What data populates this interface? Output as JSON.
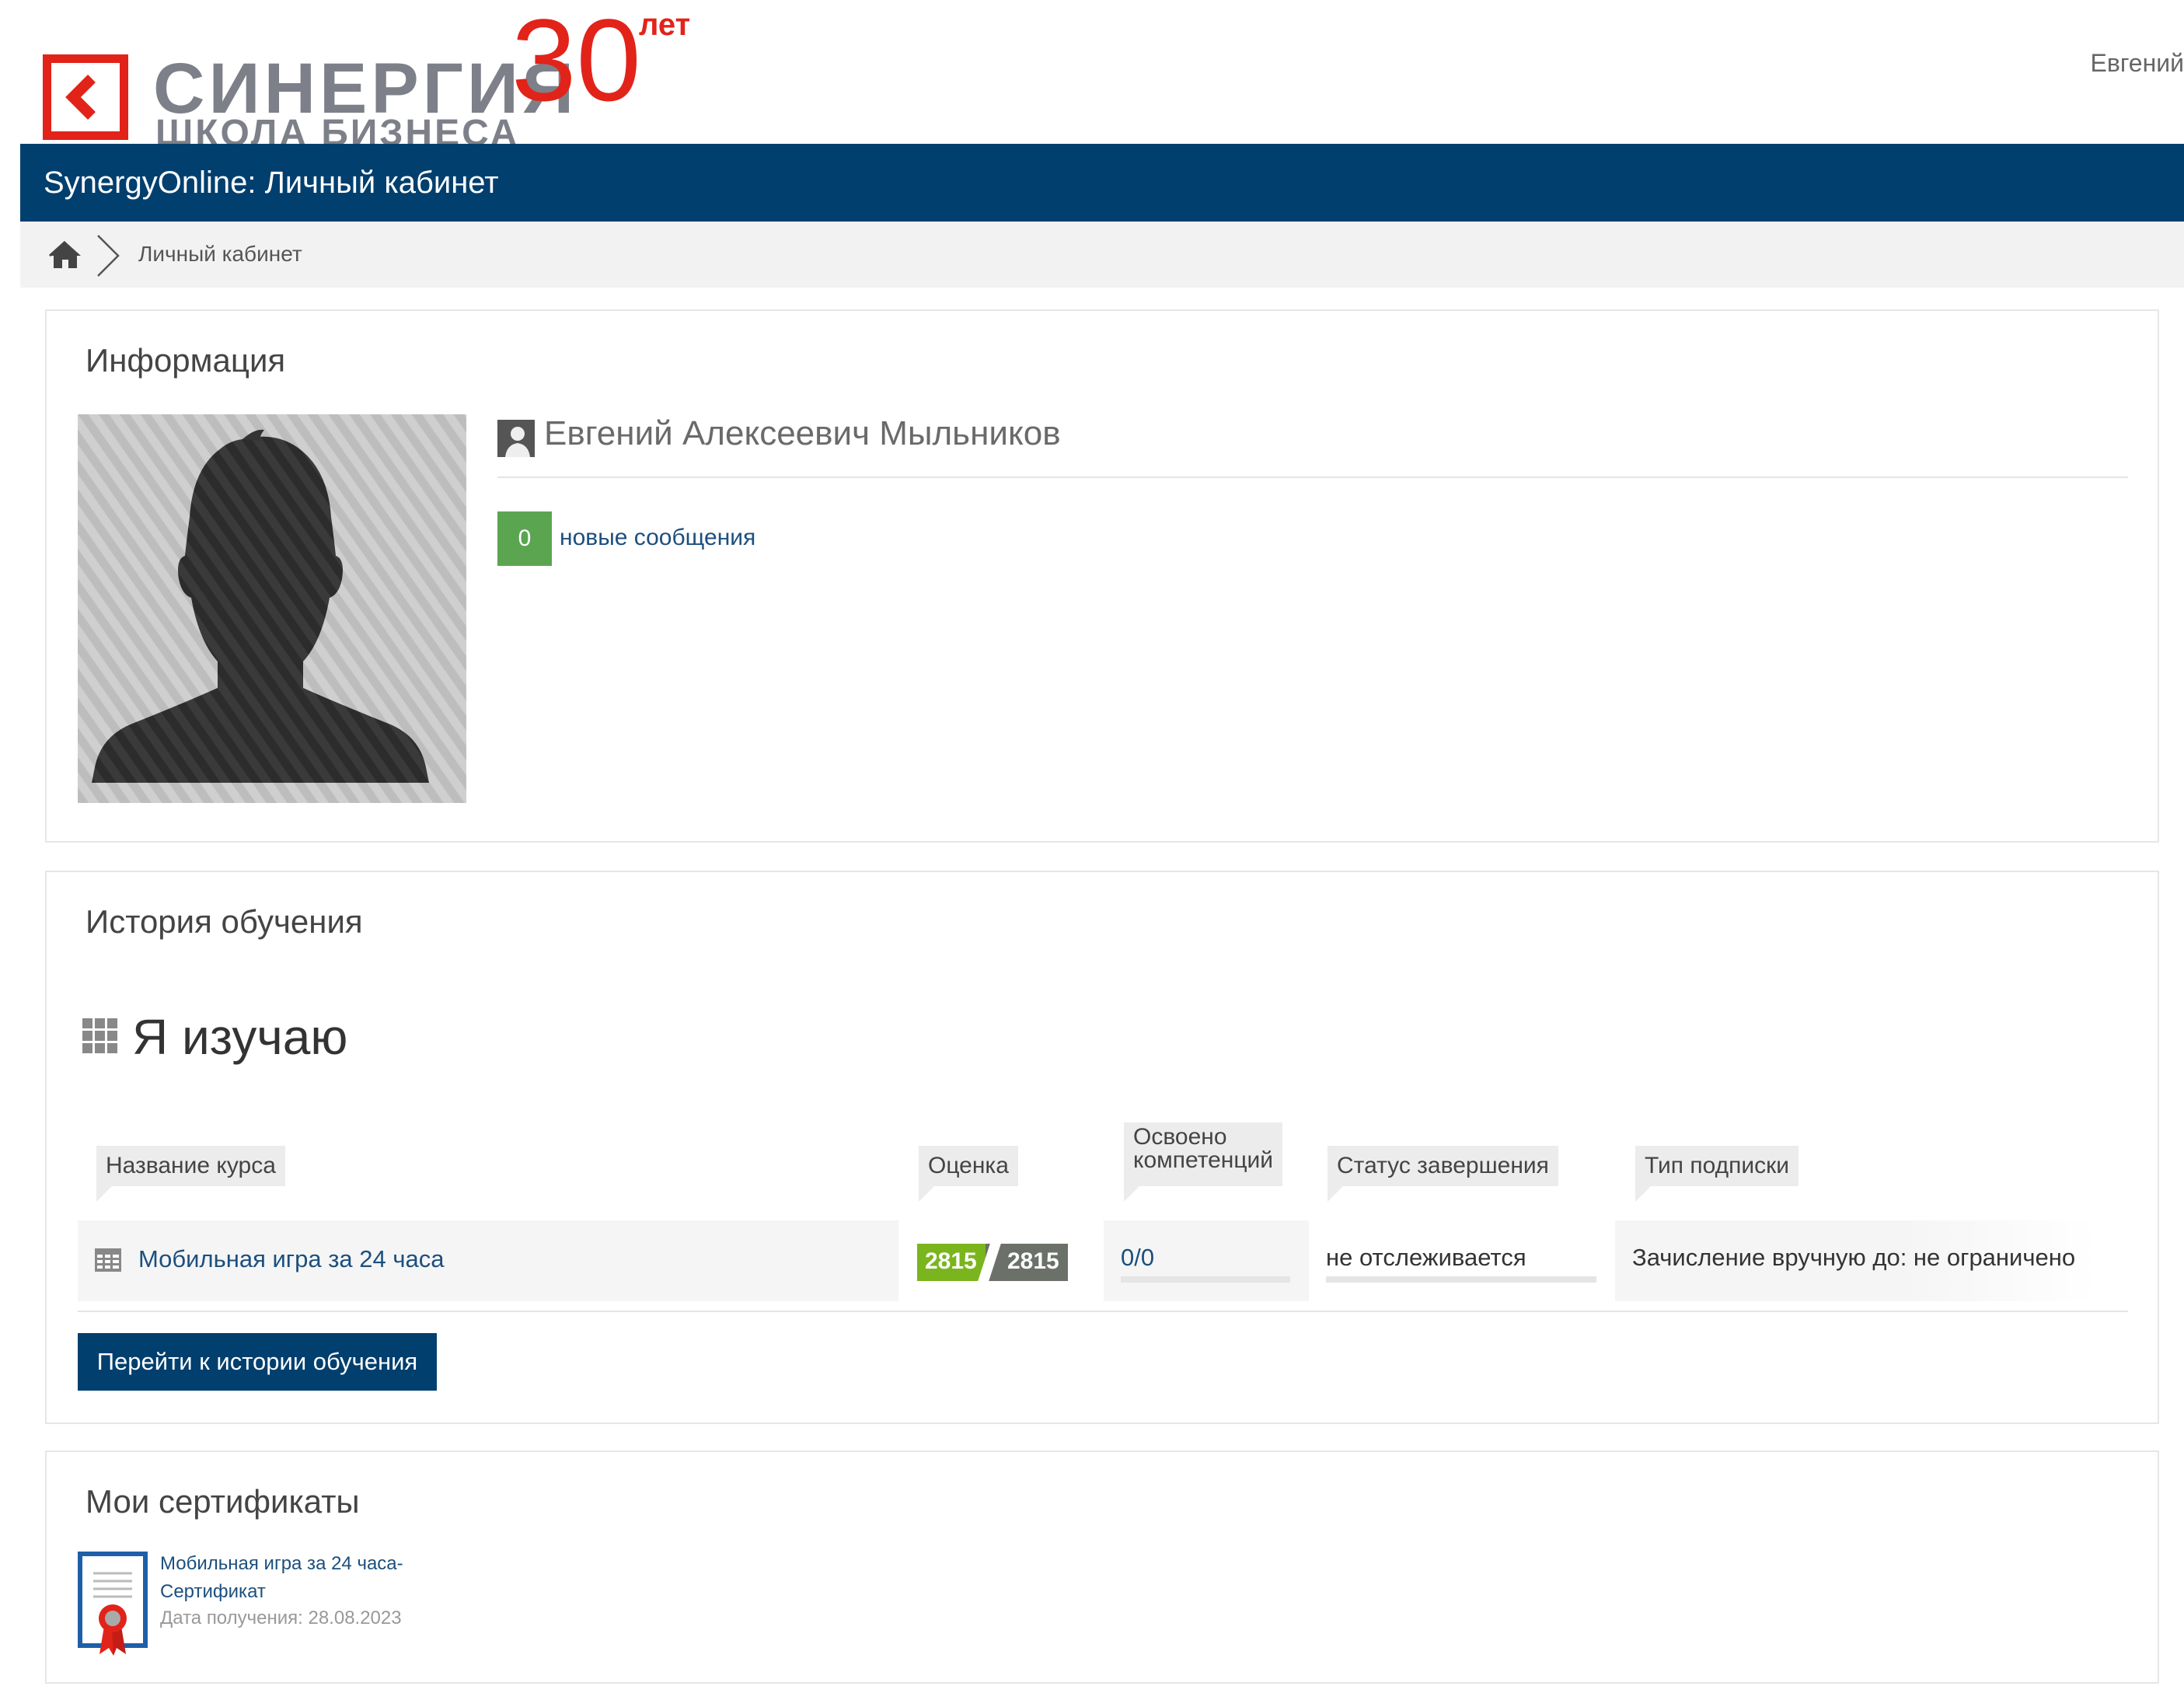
{
  "header": {
    "logo_brand": "СИНЕРГИЯ",
    "logo_subtitle": "ШКОЛА БИЗНЕСА",
    "logo_anniversary_number": "30",
    "logo_anniversary_word": "лет",
    "user_name": "Евгений"
  },
  "navbar": {
    "title": "SynergyOnline: Личный кабинет"
  },
  "breadcrumb": {
    "home_icon": "home-icon",
    "current": "Личный кабинет"
  },
  "info": {
    "title": "Информация",
    "full_name": "Евгений Алексеевич Мыльников",
    "messages_count": "0",
    "messages_label": "новые сообщения"
  },
  "history": {
    "title": "История обучения",
    "studying_title": "Я изучаю",
    "columns": {
      "course": "Название курса",
      "grade": "Оценка",
      "competencies_line1": "Освоено",
      "competencies_line2": "компетенций",
      "status": "Статус завершения",
      "subscription": "Тип подписки"
    },
    "rows": [
      {
        "course": "Мобильная игра за 24 часа",
        "grade_left": "2815",
        "grade_right": "2815",
        "competencies": "0/0",
        "status": "не отслеживается",
        "subscription": "Зачисление вручную до: не ограничено"
      }
    ],
    "button_label": "Перейти к истории обучения"
  },
  "certificates": {
    "title": "Мои сертификаты",
    "items": [
      {
        "name": "Мобильная игра за 24 часа-Сертификат",
        "date_label": "Дата получения:",
        "date": "28.08.2023"
      }
    ]
  },
  "colors": {
    "brand_red": "#e2231a",
    "navbar_blue": "#003f6e",
    "link_blue": "#1c4f7e",
    "badge_green": "#5ba551",
    "grade_green": "#7ab51d",
    "grade_gray": "#6b7068"
  }
}
